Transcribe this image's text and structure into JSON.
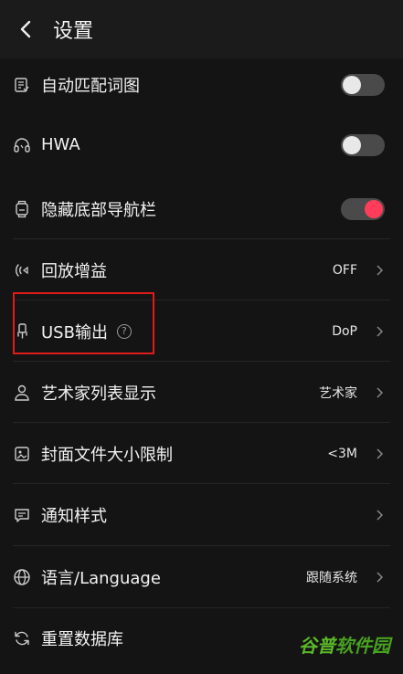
{
  "header": {
    "title": "设置"
  },
  "rows": [
    {
      "label": "自动匹配词图",
      "icon": "lyrics-image-icon",
      "toggle": false
    },
    {
      "label": "HWA",
      "icon": "headphones-icon",
      "toggle": false
    },
    {
      "label": "隐藏底部导航栏",
      "icon": "watch-icon",
      "toggle": true
    },
    {
      "label": "回放增益",
      "icon": "signal-waves-icon",
      "value": "OFF"
    },
    {
      "label": "USB输出",
      "icon": "usb-plug-icon",
      "help": "?",
      "value": "DoP"
    },
    {
      "label": "艺术家列表显示",
      "icon": "person-icon",
      "value": "艺术家"
    },
    {
      "label": "封面文件大小限制",
      "icon": "cover-image-icon",
      "value": "<3M"
    },
    {
      "label": "通知样式",
      "icon": "message-icon",
      "value": ""
    },
    {
      "label": "语言/Language",
      "icon": "globe-icon",
      "value": "跟随系统"
    },
    {
      "label": "重置数据库",
      "icon": "refresh-icon"
    }
  ],
  "watermark": {
    "part_a": "谷普",
    "part_b": "软件园"
  },
  "colors": {
    "accent": "#ff3d5a",
    "highlight_box": "#e01b1b",
    "background": "#141414"
  }
}
